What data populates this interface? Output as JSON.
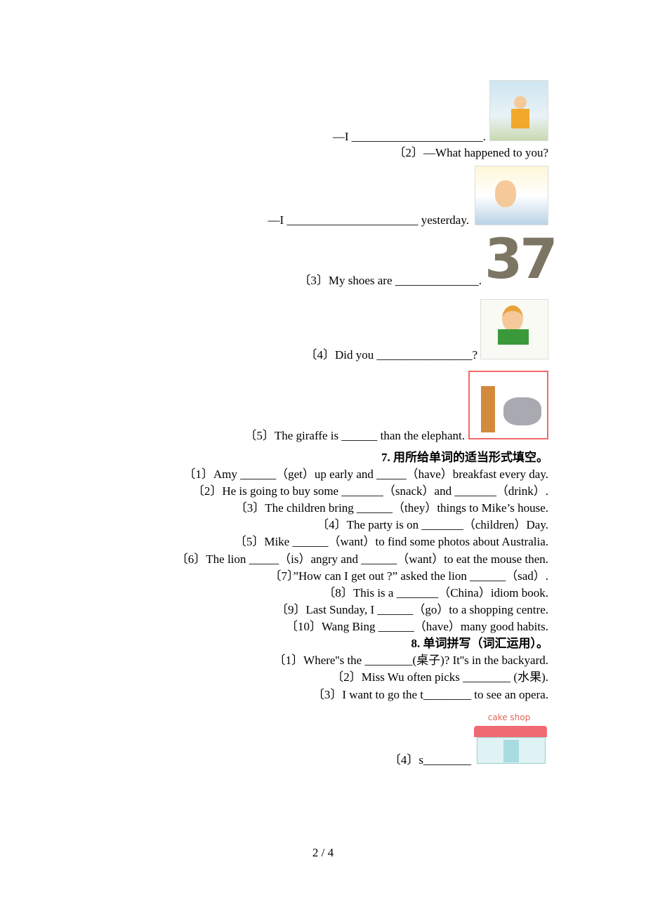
{
  "section6": {
    "q1_answer_line": "—I ______________________.",
    "q2": "〔2〕—What happened to you?",
    "q2_answer_line": "—I ______________________ yesterday.",
    "q3": "〔3〕My shoes are ______________.",
    "q3_image_text": "37",
    "q4": "〔4〕Did you ________________?",
    "q5": "〔5〕The giraffe is ______ than the elephant."
  },
  "section7": {
    "heading": "7. 用所给单词的适当形式填空。",
    "items": [
      "〔1〕Amy ______（get）up early and _____（have）breakfast every day.",
      "〔2〕He is going to buy some _______（snack）and _______（drink）.",
      "〔3〕The children bring ______（they）things to Mike’s house.",
      "〔4〕The party is on _______（children）Day.",
      "〔5〕Mike ______（want）to find some photos about Australia.",
      "〔6〕The lion _____（is）angry and ______（want）to eat the mouse then.",
      "〔7〕”How can I get out ?” asked the lion ______（sad）.",
      "〔8〕This is a _______（China）idiom book.",
      "〔9〕Last Sunday, I ______（go）to a shopping centre.",
      "〔10〕Wang Bing ______（have）many good habits."
    ]
  },
  "section8": {
    "heading": "8. 单词拼写（词汇运用）。",
    "items": [
      "〔1〕Where''s the ________(桌子)? It''s in the backyard.",
      "〔2〕Miss Wu often picks ________ (水果).",
      "〔3〕I want to go the t________ to see an opera.",
      "〔4〕s________"
    ],
    "cake_shop_sign": "cake shop"
  },
  "footer": {
    "page": "2 / 4"
  }
}
